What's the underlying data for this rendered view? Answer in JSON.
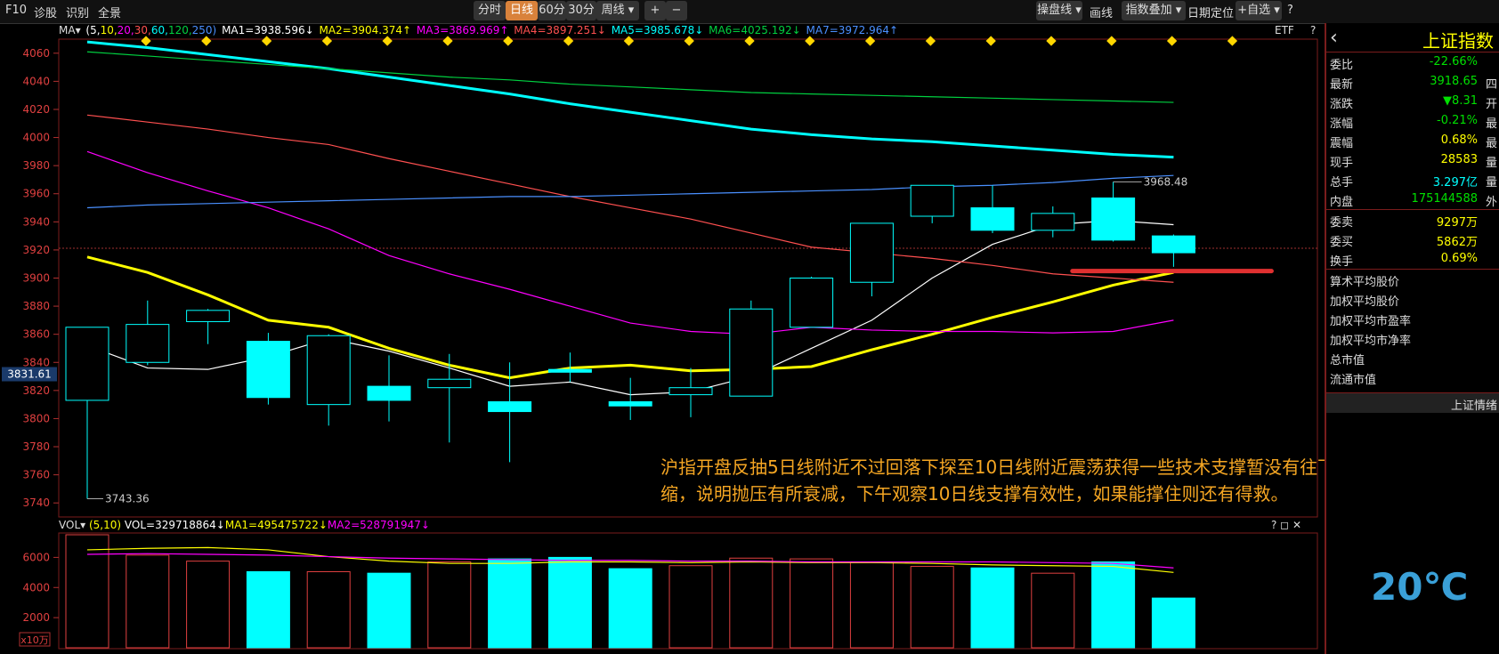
{
  "toolbar": {
    "left": [
      "F10",
      "诊股",
      "识别",
      "全景"
    ],
    "periods": [
      "分时",
      "日线",
      "60分",
      "30分",
      "周线 ▾"
    ],
    "active_period": "日线",
    "zoom": [
      "+",
      "−"
    ],
    "right": [
      "操盘线 ▾",
      "画线",
      "指数叠加 ▾",
      "日期定位",
      "+自选 ▾",
      "?"
    ]
  },
  "ma_bar": {
    "label": "MA▾",
    "params_open": "(5,",
    "params": [
      "10,",
      "20,",
      "30,",
      "60,",
      "120,",
      "250)"
    ],
    "items": [
      {
        "text": "MA1=3938.596↓",
        "color": "#ffffff"
      },
      {
        "text": "MA2=3904.374↑",
        "color": "#ffff00"
      },
      {
        "text": "MA3=3869.969↑",
        "color": "#ff00ff"
      },
      {
        "text": "MA4=3897.251↓",
        "color": "#ff5050"
      },
      {
        "text": "MA5=3985.678↓",
        "color": "#00ffff"
      },
      {
        "text": "MA6=4025.192↓",
        "color": "#00d040"
      },
      {
        "text": "MA7=3972.964↑",
        "color": "#4a90ff"
      }
    ],
    "etf": "ETF",
    "help": "?"
  },
  "vol_bar": {
    "label": "VOL▾",
    "params": "(5,10)",
    "items": [
      {
        "text": "VOL=329718864↓",
        "color": "#ffffff"
      },
      {
        "text": "MA1=495475722↓",
        "color": "#ffff00"
      },
      {
        "text": "MA2=528791947↓",
        "color": "#ff00ff"
      }
    ],
    "icons": "? ◻ ✕",
    "multiplier": "x10万"
  },
  "chart_data": {
    "type": "candlestick",
    "ylim": [
      3730,
      4070
    ],
    "y_ticks": [
      4060,
      4040,
      4020,
      4000,
      3980,
      3960,
      3940,
      3920,
      3900,
      3880,
      3860,
      3840,
      3820,
      3800,
      3780,
      3760,
      3740
    ],
    "cursor_price": "3831.61",
    "high_label": "3968.48",
    "low_label": "3743.36",
    "candles": [
      {
        "o": 3813,
        "c": 3865,
        "h": 3865,
        "l": 3743
      },
      {
        "o": 3840,
        "c": 3867,
        "h": 3884,
        "l": 3838
      },
      {
        "o": 3869,
        "c": 3877,
        "h": 3878,
        "l": 3853
      },
      {
        "o": 3855,
        "c": 3815,
        "h": 3861,
        "l": 3810
      },
      {
        "o": 3810,
        "c": 3859,
        "h": 3860,
        "l": 3795
      },
      {
        "o": 3823,
        "c": 3813,
        "h": 3845,
        "l": 3798
      },
      {
        "o": 3822,
        "c": 3828,
        "h": 3846,
        "l": 3783
      },
      {
        "o": 3812,
        "c": 3805,
        "h": 3840,
        "l": 3769
      },
      {
        "o": 3835,
        "c": 3833,
        "h": 3847,
        "l": 3826
      },
      {
        "o": 3812,
        "c": 3809,
        "h": 3829,
        "l": 3799
      },
      {
        "o": 3817,
        "c": 3822,
        "h": 3836,
        "l": 3801
      },
      {
        "o": 3816,
        "c": 3878,
        "h": 3884,
        "l": 3816
      },
      {
        "o": 3865,
        "c": 3900,
        "h": 3901,
        "l": 3865
      },
      {
        "o": 3897,
        "c": 3939,
        "h": 3939,
        "l": 3887
      },
      {
        "o": 3944,
        "c": 3966,
        "h": 3966,
        "l": 3939
      },
      {
        "o": 3950,
        "c": 3934,
        "h": 3966,
        "l": 3932
      },
      {
        "o": 3934,
        "c": 3946,
        "h": 3951,
        "l": 3929
      },
      {
        "o": 3957,
        "c": 3927,
        "h": 3968.48,
        "l": 3926
      },
      {
        "o": 3930,
        "c": 3918,
        "h": 3931,
        "l": 3908
      }
    ],
    "series": [
      {
        "name": "MA1",
        "color": "#ffffff",
        "values": [
          3852,
          3836,
          3835,
          3844,
          3857,
          3848,
          3836,
          3823,
          3826,
          3817,
          3819,
          3830,
          3850,
          3870,
          3900,
          3924,
          3938,
          3941,
          3938
        ]
      },
      {
        "name": "MA2",
        "color": "#ffff00",
        "values": [
          3915,
          3904,
          3888,
          3870,
          3865,
          3850,
          3838,
          3829,
          3836,
          3838,
          3834,
          3835,
          3837,
          3849,
          3860,
          3872,
          3883,
          3895,
          3904
        ]
      },
      {
        "name": "MA3",
        "color": "#ff00ff",
        "values": [
          3990,
          3975,
          3962,
          3950,
          3935,
          3916,
          3903,
          3892,
          3880,
          3868,
          3862,
          3860,
          3865,
          3863,
          3862,
          3862,
          3861,
          3862,
          3870
        ]
      },
      {
        "name": "MA4",
        "color": "#ff5050",
        "values": [
          4016,
          4011,
          4006,
          4000,
          3995,
          3985,
          3976,
          3967,
          3958,
          3950,
          3942,
          3932,
          3922,
          3918,
          3914,
          3909,
          3903,
          3900,
          3897
        ]
      },
      {
        "name": "MA5",
        "color": "#00ffff",
        "values": [
          4068,
          4064,
          4059,
          4054,
          4049,
          4043,
          4037,
          4031,
          4024,
          4018,
          4012,
          4006,
          4002,
          3999,
          3997,
          3994,
          3991,
          3988,
          3986
        ]
      },
      {
        "name": "MA6",
        "color": "#00d040",
        "values": [
          4061,
          4058,
          4055,
          4052,
          4049,
          4046,
          4043,
          4041,
          4038,
          4036,
          4034,
          4032,
          4031,
          4030,
          4029,
          4028,
          4027,
          4026,
          4025
        ]
      },
      {
        "name": "MA7",
        "color": "#4a90ff",
        "values": [
          3950,
          3952,
          3953,
          3954,
          3955,
          3956,
          3957,
          3958,
          3958,
          3959,
          3960,
          3961,
          3962,
          3963,
          3965,
          3966,
          3968,
          3971,
          3973
        ]
      }
    ],
    "support_line": 3905,
    "volume": {
      "ylim": [
        0,
        7500
      ],
      "y_ticks": [
        6000,
        4000,
        2000
      ],
      "values": [
        7500,
        6150,
        5750,
        5050,
        5050,
        4950,
        5700,
        5900,
        6000,
        5250,
        5450,
        5950,
        5900,
        5650,
        5400,
        5300,
        4950,
        5700,
        3300
      ],
      "ma5": [
        6500,
        6600,
        6650,
        6500,
        6050,
        5750,
        5600,
        5600,
        5700,
        5700,
        5650,
        5700,
        5650,
        5650,
        5600,
        5500,
        5450,
        5400,
        5000
      ],
      "ma10": [
        6200,
        6250,
        6200,
        6150,
        6050,
        5950,
        5900,
        5850,
        5800,
        5800,
        5750,
        5750,
        5700,
        5700,
        5700,
        5700,
        5650,
        5600,
        5300
      ]
    }
  },
  "right_panel": {
    "title": "上证指数",
    "rows1": [
      {
        "k": "委比",
        "v": "-22.66%",
        "c": "#00e000",
        "x": ""
      },
      {
        "k": "最新",
        "v": "3918.65",
        "c": "#00e000",
        "x": "四"
      },
      {
        "k": "涨跌",
        "v": "▼8.31",
        "c": "#00e000",
        "x": "开"
      },
      {
        "k": "涨幅",
        "v": "-0.21%",
        "c": "#00e000",
        "x": "最"
      },
      {
        "k": "震幅",
        "v": "0.68%",
        "c": "#ffff00",
        "x": "最"
      },
      {
        "k": "现手",
        "v": "28583",
        "c": "#ffff00",
        "x": "量"
      },
      {
        "k": "总手",
        "v": "3.297亿",
        "c": "#00ffff",
        "x": "量"
      },
      {
        "k": "内盘",
        "v": "175144588",
        "c": "#00e000",
        "x": "外"
      }
    ],
    "rows2": [
      {
        "k": "委卖",
        "v": "9297万",
        "c": "#ffff00",
        "x": ""
      },
      {
        "k": "委买",
        "v": "5862万",
        "c": "#ffff00",
        "x": ""
      },
      {
        "k": "换手",
        "v": "0.69%",
        "c": "#ffff00",
        "x": ""
      }
    ],
    "links": [
      "算术平均股价",
      "加权平均股价",
      "加权平均市盈率",
      "加权平均市净率",
      "总市值",
      "流通市值"
    ],
    "section": "上证情绪"
  },
  "annotation": "沪指开盘反抽5日线附近不过回落下探至10日线附近震荡获得一些技术支撑暂没有往下破位，成交量萎缩，说明抛压有所衰减，下午观察10日线支撑有效性，如果能撑住则还有得救。",
  "temperature": "20℃"
}
